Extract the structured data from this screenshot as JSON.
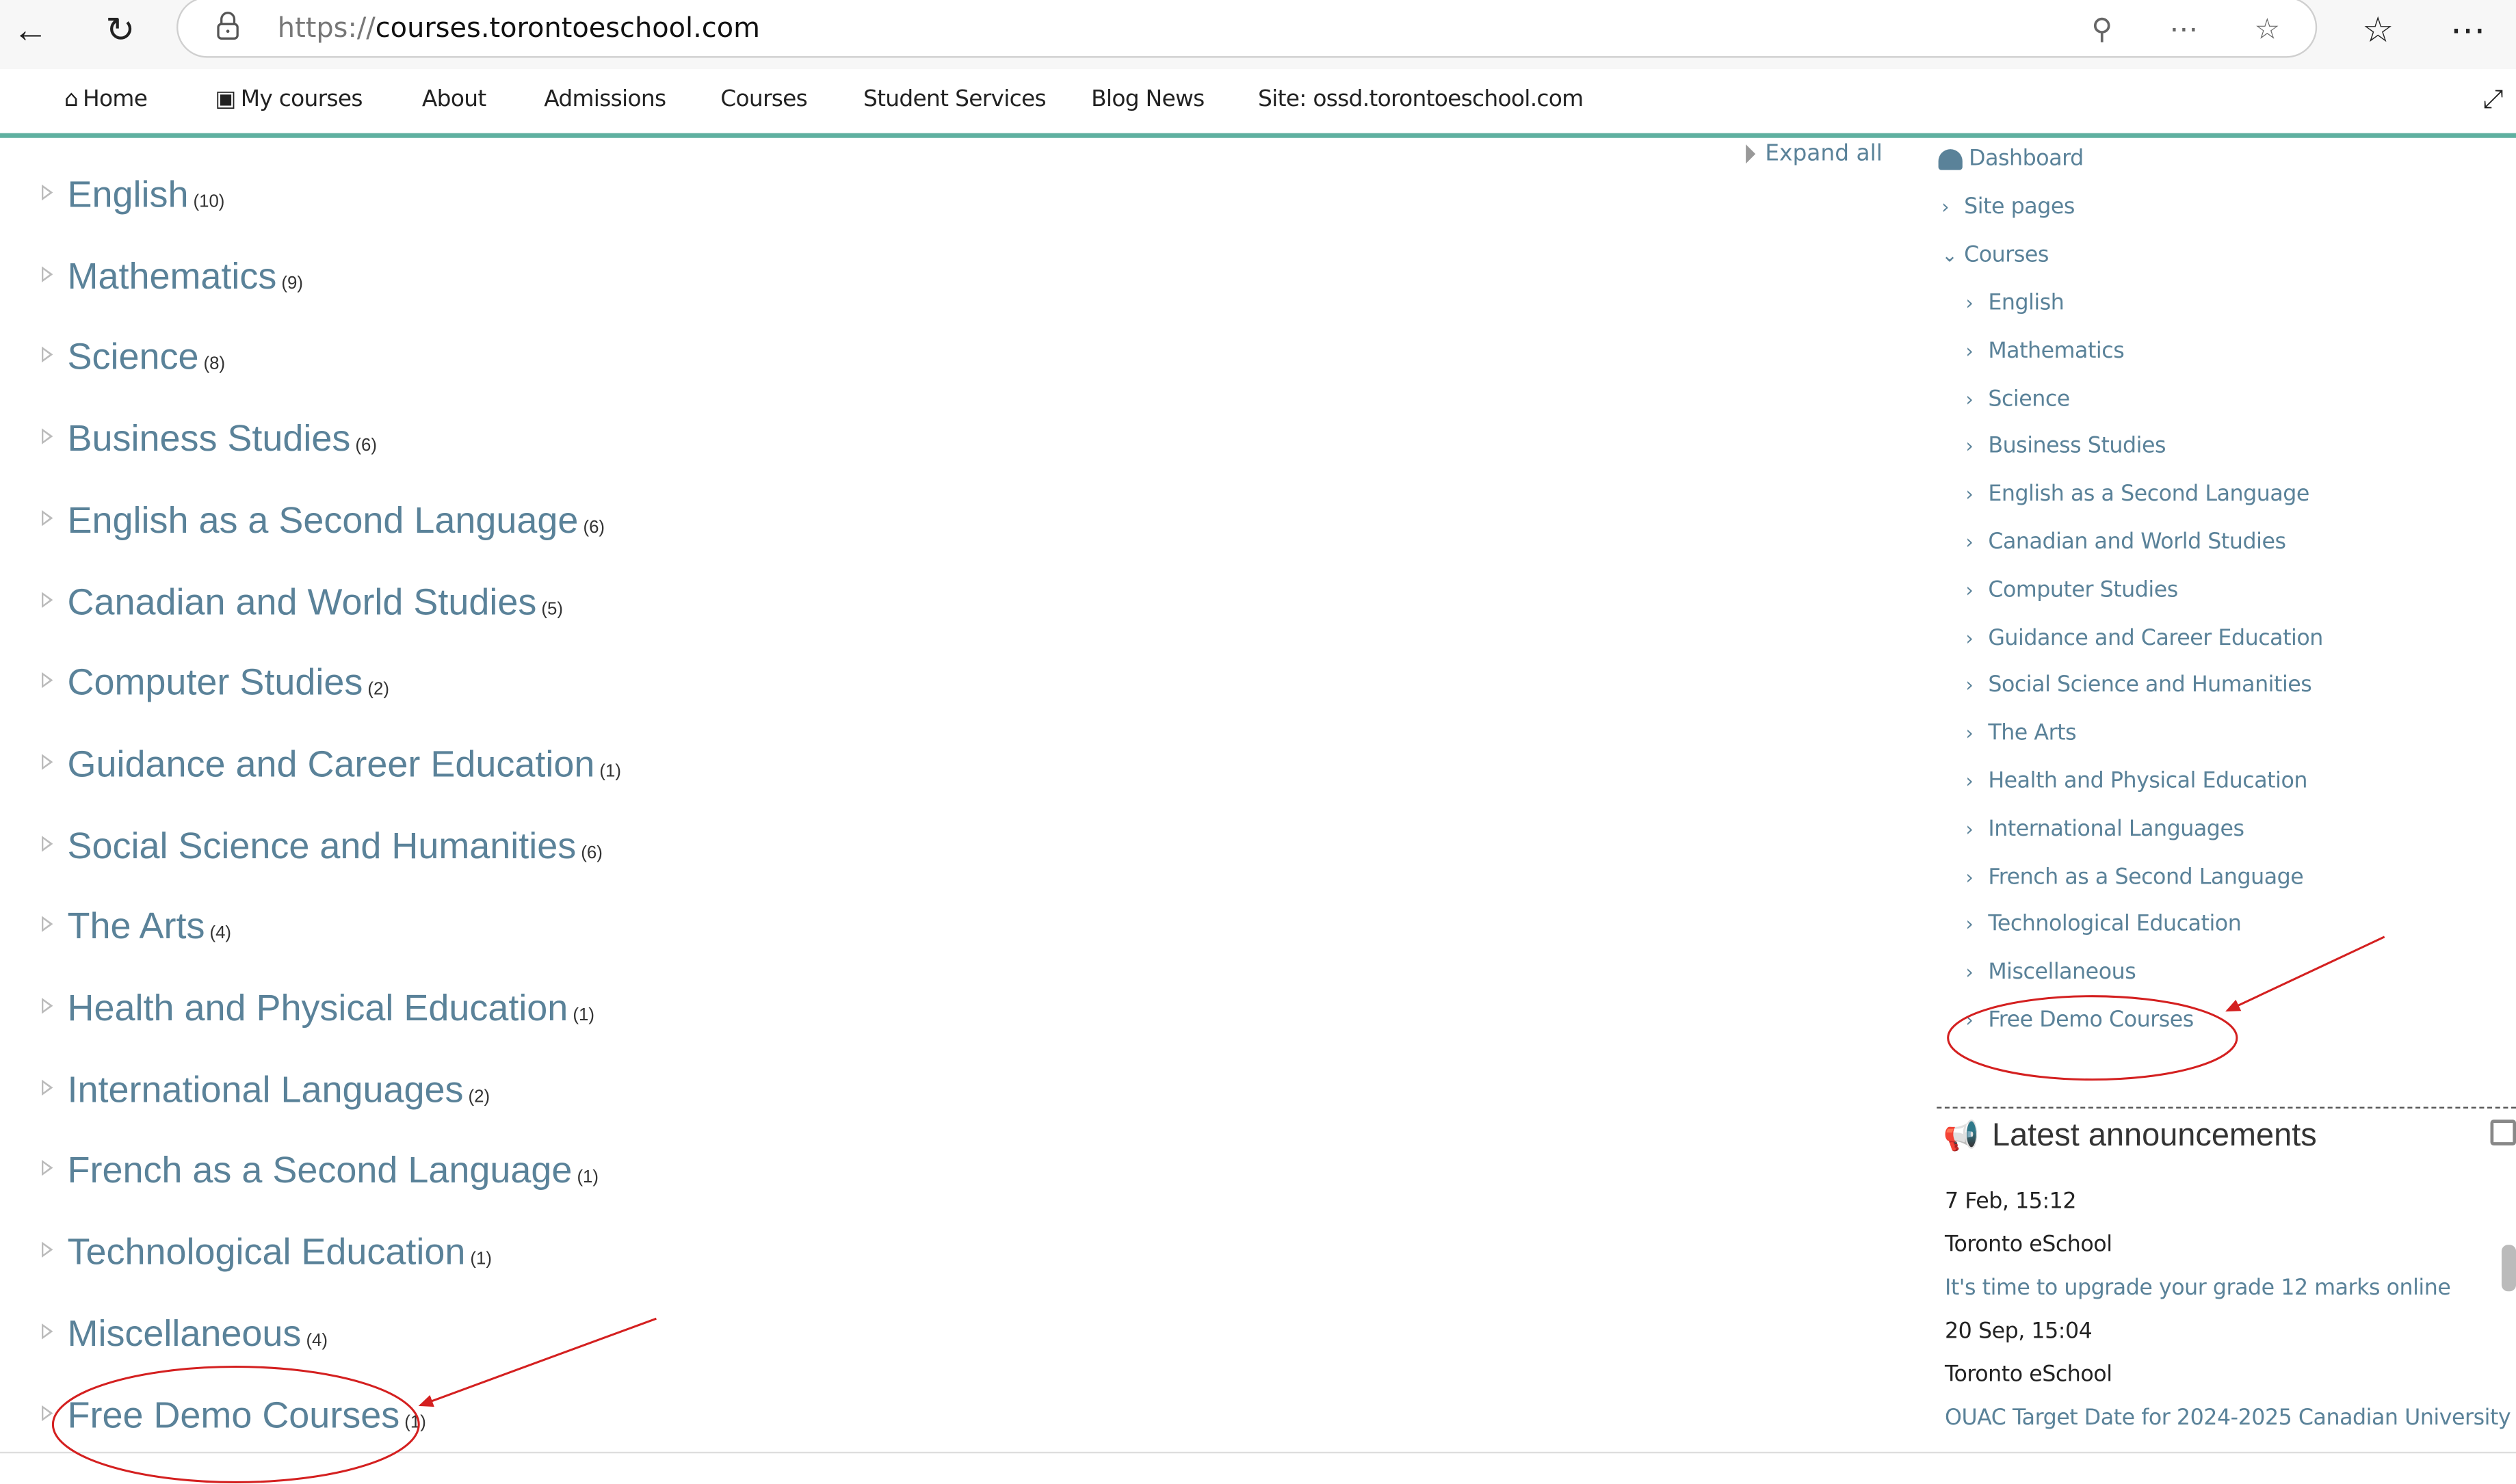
{
  "browser": {
    "url_protocol": "https://",
    "url_host": "courses.torontoeschool.com",
    "icons": [
      "back-icon",
      "refresh-icon",
      "lock-icon",
      "zoom-out-icon",
      "more-tools-icon",
      "favorite-icon",
      "favorites-list-icon",
      "settings-more-icon"
    ]
  },
  "nav": {
    "items": [
      {
        "label": "Home",
        "icon": "home-icon"
      },
      {
        "label": "My courses",
        "icon": "briefcase-icon"
      },
      {
        "label": "About"
      },
      {
        "label": "Admissions"
      },
      {
        "label": "Courses"
      },
      {
        "label": "Student Services"
      },
      {
        "label": "Blog News"
      },
      {
        "label": "Site: ossd.torontoeschool.com"
      }
    ]
  },
  "categories": [
    {
      "name": "English",
      "count": "(10)"
    },
    {
      "name": "Mathematics",
      "count": "(9)"
    },
    {
      "name": "Science",
      "count": "(8)"
    },
    {
      "name": "Business Studies",
      "count": "(6)"
    },
    {
      "name": "English as a Second Language",
      "count": "(6)"
    },
    {
      "name": "Canadian and World Studies",
      "count": "(5)"
    },
    {
      "name": "Computer Studies",
      "count": "(2)"
    },
    {
      "name": "Guidance and Career Education",
      "count": "(1)"
    },
    {
      "name": "Social Science and Humanities",
      "count": "(6)"
    },
    {
      "name": "The Arts",
      "count": "(4)"
    },
    {
      "name": "Health and Physical Education",
      "count": "(1)"
    },
    {
      "name": "International Languages",
      "count": "(2)"
    },
    {
      "name": "French as a Second Language",
      "count": "(1)"
    },
    {
      "name": "Technological Education",
      "count": "(1)"
    },
    {
      "name": "Miscellaneous",
      "count": "(4)"
    },
    {
      "name": "Free Demo Courses",
      "count": "(1)"
    }
  ],
  "expand_all": "Expand all",
  "navigation": {
    "dashboard": "Dashboard",
    "site_pages": "Site pages",
    "courses": "Courses",
    "course_items": [
      "English",
      "Mathematics",
      "Science",
      "Business Studies",
      "English as a Second Language",
      "Canadian and World Studies",
      "Computer Studies",
      "Guidance and Career Education",
      "Social Science and Humanities",
      "The Arts",
      "Health and Physical Education",
      "International Languages",
      "French as a Second Language",
      "Technological Education",
      "Miscellaneous",
      "Free Demo Courses"
    ]
  },
  "announcements": {
    "title": "Latest announcements",
    "items": [
      {
        "date": "7 Feb, 15:12",
        "author": "Toronto eSchool",
        "subject": "It's time to upgrade your grade 12 marks online"
      },
      {
        "date": "20 Sep, 15:04",
        "author": "Toronto eSchool",
        "subject": "OUAC Target Date for 2024-2025 Canadian University"
      }
    ]
  },
  "annotation_color": "#d42020"
}
